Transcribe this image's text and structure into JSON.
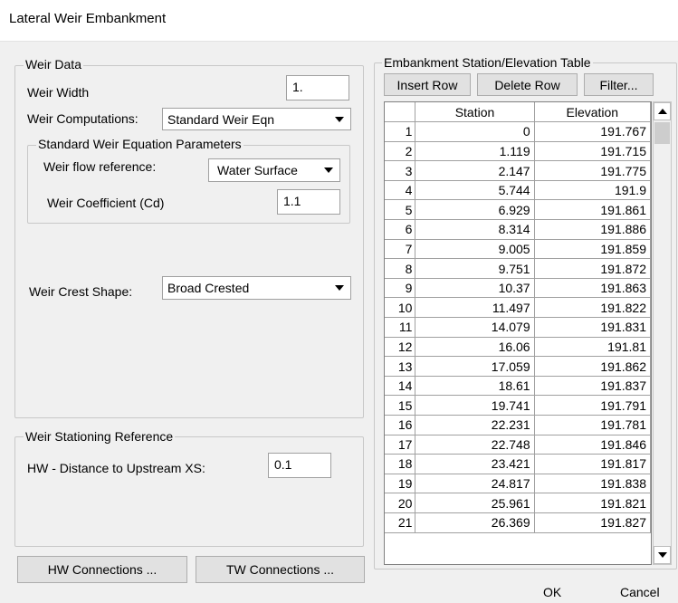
{
  "window": {
    "title": "Lateral Weir Embankment"
  },
  "weir_data": {
    "legend": "Weir Data",
    "width_label": "Weir Width",
    "width_value": "1.",
    "computations_label": "Weir Computations:",
    "computations_value": "Standard Weir Eqn",
    "std_params": {
      "legend": "Standard Weir Equation Parameters",
      "flow_ref_label": "Weir flow reference:",
      "flow_ref_value": "Water Surface",
      "cd_label": "Weir Coefficient (Cd)",
      "cd_value": "1.1"
    },
    "crest_label": "Weir Crest Shape:",
    "crest_value": "Broad Crested"
  },
  "stationing": {
    "legend": "Weir Stationing Reference",
    "hw_label": "HW - Distance to Upstream XS:",
    "hw_value": "0.1"
  },
  "buttons": {
    "hw_connections": "HW Connections ...",
    "tw_connections": "TW Connections ...",
    "ok": "OK",
    "cancel": "Cancel"
  },
  "table": {
    "legend": "Embankment Station/Elevation Table",
    "insert_row": "Insert Row",
    "delete_row": "Delete Row",
    "filter": "Filter...",
    "headers": [
      "",
      "Station",
      "Elevation"
    ],
    "rows": [
      [
        "1",
        "0",
        "191.767"
      ],
      [
        "2",
        "1.119",
        "191.715"
      ],
      [
        "3",
        "2.147",
        "191.775"
      ],
      [
        "4",
        "5.744",
        "191.9"
      ],
      [
        "5",
        "6.929",
        "191.861"
      ],
      [
        "6",
        "8.314",
        "191.886"
      ],
      [
        "7",
        "9.005",
        "191.859"
      ],
      [
        "8",
        "9.751",
        "191.872"
      ],
      [
        "9",
        "10.37",
        "191.863"
      ],
      [
        "10",
        "11.497",
        "191.822"
      ],
      [
        "11",
        "14.079",
        "191.831"
      ],
      [
        "12",
        "16.06",
        "191.81"
      ],
      [
        "13",
        "17.059",
        "191.862"
      ],
      [
        "14",
        "18.61",
        "191.837"
      ],
      [
        "15",
        "19.741",
        "191.791"
      ],
      [
        "16",
        "22.231",
        "191.781"
      ],
      [
        "17",
        "22.748",
        "191.846"
      ],
      [
        "18",
        "23.421",
        "191.817"
      ],
      [
        "19",
        "24.817",
        "191.838"
      ],
      [
        "20",
        "25.961",
        "191.821"
      ],
      [
        "21",
        "26.369",
        "191.827"
      ]
    ]
  },
  "icons": {
    "dropdown": "chevron-down-icon",
    "scroll_up": "scroll-up-icon",
    "scroll_down": "scroll-down-icon"
  }
}
